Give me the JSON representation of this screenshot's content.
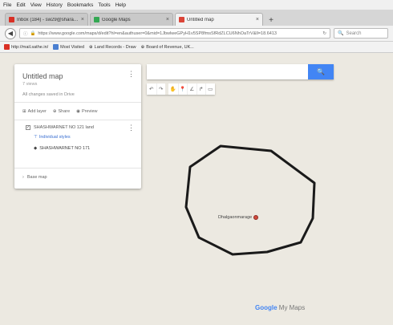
{
  "menubar": [
    "File",
    "Edit",
    "View",
    "History",
    "Bookmarks",
    "Tools",
    "Help"
  ],
  "tabs": [
    {
      "label": "Inbox (184) - sw29@sharan...",
      "favicon_color": "#d93025",
      "active": false
    },
    {
      "label": "Google Maps",
      "favicon_color": "#34a853",
      "active": false
    },
    {
      "label": "Untitled map",
      "favicon_color": "#db4437",
      "active": true
    }
  ],
  "nav": {
    "url": "https://www.google.com/maps/d/edit?hl=en&authuser=0&mid=1JbwlweGPyH1v5SP8fmsSfRdZLCU6NhOaTrV&ll=18.6413",
    "search_placeholder": "Search"
  },
  "bookmarks": [
    {
      "label": "http://mail.sathe.in/",
      "color": "#d93025"
    },
    {
      "label": "Most Visited",
      "color": "#4a7fd1"
    },
    {
      "label": "Land Records - Draw",
      "color": "#888888"
    },
    {
      "label": "Board of Revenue, UK...",
      "color": "#888888"
    }
  ],
  "panel": {
    "title": "Untitled map",
    "views": "7 views",
    "saved_status": "All changes saved in Drive",
    "actions": {
      "add_layer": "Add layer",
      "share": "Share",
      "preview": "Preview"
    },
    "layer": {
      "name": "SHASHWARNET NO 121 land",
      "style": "Individual styles",
      "feature": "SHASHWARNET NO 171"
    },
    "base_map": "Base map"
  },
  "search": {
    "placeholder": ""
  },
  "map": {
    "place_label": "Dhalgaonmarage",
    "polygon_color": "#1a1a1a",
    "logo_google": "Google",
    "logo_mymaps": "My Maps"
  },
  "colors": {
    "accent": "#4285f4",
    "map_bg": "#ece9e1"
  }
}
